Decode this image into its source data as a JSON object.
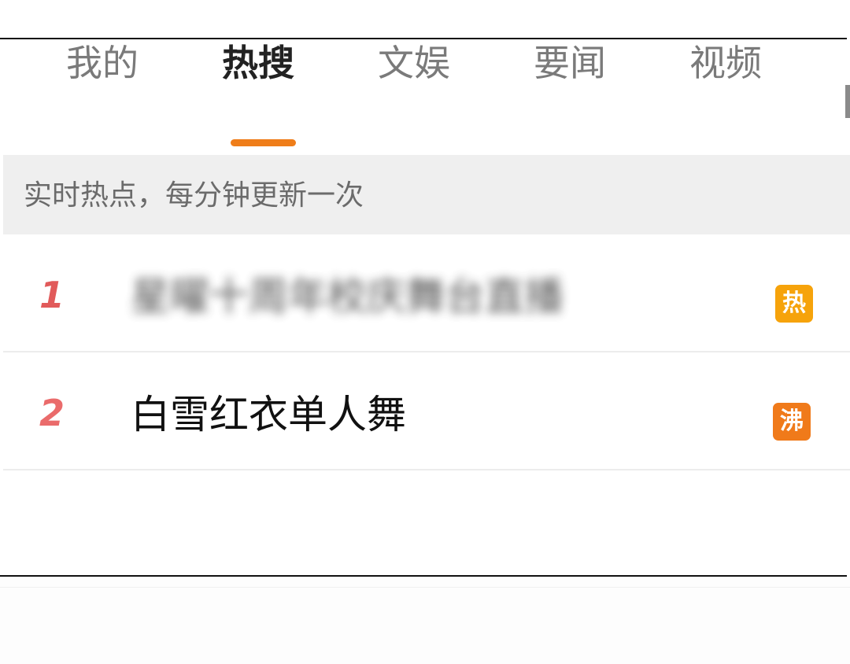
{
  "tabs": [
    {
      "label": "我的",
      "active": false
    },
    {
      "label": "热搜",
      "active": true
    },
    {
      "label": "文娱",
      "active": false
    },
    {
      "label": "要闻",
      "active": false
    },
    {
      "label": "视频",
      "active": false
    }
  ],
  "info_strip": {
    "text": "实时热点，每分钟更新一次"
  },
  "hot_list": [
    {
      "rank": "1",
      "title": "星曜十周年校庆舞台直播",
      "badge": "热",
      "badge_color": "#f6a30b",
      "blurred": true
    },
    {
      "rank": "2",
      "title": "白雪红衣单人舞",
      "badge": "沸",
      "badge_color": "#f07a1a",
      "blurred": false
    }
  ],
  "colors": {
    "accent": "#ef7d19",
    "rank": "#ea6b6b",
    "strip_background": "#efefef"
  }
}
